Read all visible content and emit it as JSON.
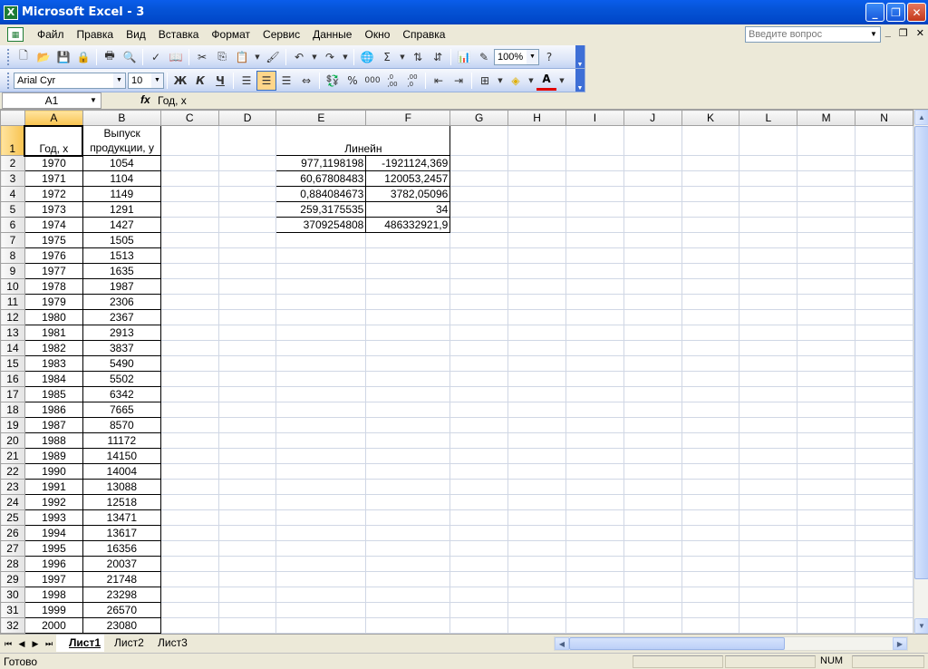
{
  "window": {
    "title": "Microsoft Excel - 3",
    "app_icon_letter": "X",
    "buttons": [
      "_",
      "❐",
      "✕"
    ]
  },
  "menu": {
    "items": [
      "Файл",
      "Правка",
      "Вид",
      "Вставка",
      "Формат",
      "Сервис",
      "Данные",
      "Окно",
      "Справка"
    ],
    "question_placeholder": "Введите вопрос",
    "doc_controls": [
      "_",
      "❐",
      "✕"
    ]
  },
  "toolbar_standard": {
    "zoom": "100%"
  },
  "toolbar_formatting": {
    "font": "Arial Cyr",
    "size": "10",
    "bold": "Ж",
    "italic": "К",
    "underline": "Ч",
    "percent": "%",
    "thousands": "000",
    "dec_inc": ",0\n,00",
    "dec_dec": ",00\n,0"
  },
  "formula_bar": {
    "name_box": "A1",
    "fx": "fx",
    "formula": "Год, х"
  },
  "columns": [
    "A",
    "B",
    "C",
    "D",
    "E",
    "F",
    "G",
    "H",
    "I",
    "J",
    "K",
    "L",
    "M",
    "N"
  ],
  "header": {
    "a1": "Год, х",
    "b1_line1": "Выпуск",
    "b1_line2": "продукции, у",
    "e1": "Линейн"
  },
  "rows": [
    {
      "n": "2",
      "a": "1970",
      "b": "1054"
    },
    {
      "n": "3",
      "a": "1971",
      "b": "1104"
    },
    {
      "n": "4",
      "a": "1972",
      "b": "1149"
    },
    {
      "n": "5",
      "a": "1973",
      "b": "1291"
    },
    {
      "n": "6",
      "a": "1974",
      "b": "1427"
    },
    {
      "n": "7",
      "a": "1975",
      "b": "1505"
    },
    {
      "n": "8",
      "a": "1976",
      "b": "1513"
    },
    {
      "n": "9",
      "a": "1977",
      "b": "1635"
    },
    {
      "n": "10",
      "a": "1978",
      "b": "1987"
    },
    {
      "n": "11",
      "a": "1979",
      "b": "2306"
    },
    {
      "n": "12",
      "a": "1980",
      "b": "2367"
    },
    {
      "n": "13",
      "a": "1981",
      "b": "2913"
    },
    {
      "n": "14",
      "a": "1982",
      "b": "3837"
    },
    {
      "n": "15",
      "a": "1983",
      "b": "5490"
    },
    {
      "n": "16",
      "a": "1984",
      "b": "5502"
    },
    {
      "n": "17",
      "a": "1985",
      "b": "6342"
    },
    {
      "n": "18",
      "a": "1986",
      "b": "7665"
    },
    {
      "n": "19",
      "a": "1987",
      "b": "8570"
    },
    {
      "n": "20",
      "a": "1988",
      "b": "11172"
    },
    {
      "n": "21",
      "a": "1989",
      "b": "14150"
    },
    {
      "n": "22",
      "a": "1990",
      "b": "14004"
    },
    {
      "n": "23",
      "a": "1991",
      "b": "13088"
    },
    {
      "n": "24",
      "a": "1992",
      "b": "12518"
    },
    {
      "n": "25",
      "a": "1993",
      "b": "13471"
    },
    {
      "n": "26",
      "a": "1994",
      "b": "13617"
    },
    {
      "n": "27",
      "a": "1995",
      "b": "16356"
    },
    {
      "n": "28",
      "a": "1996",
      "b": "20037"
    },
    {
      "n": "29",
      "a": "1997",
      "b": "21748"
    },
    {
      "n": "30",
      "a": "1998",
      "b": "23298"
    },
    {
      "n": "31",
      "a": "1999",
      "b": "26570"
    },
    {
      "n": "32",
      "a": "2000",
      "b": "23080"
    }
  ],
  "linest": [
    {
      "e": "977,1198198",
      "f": "-1921124,369"
    },
    {
      "e": "60,67808483",
      "f": "120053,2457"
    },
    {
      "e": "0,884084673",
      "f": "3782,05096"
    },
    {
      "e": "259,3175535",
      "f": "34"
    },
    {
      "e": "3709254808",
      "f": "486332921,9"
    }
  ],
  "sheets": [
    "Лист1",
    "Лист2",
    "Лист3"
  ],
  "status": {
    "text": "Готово",
    "num": "NUM"
  }
}
